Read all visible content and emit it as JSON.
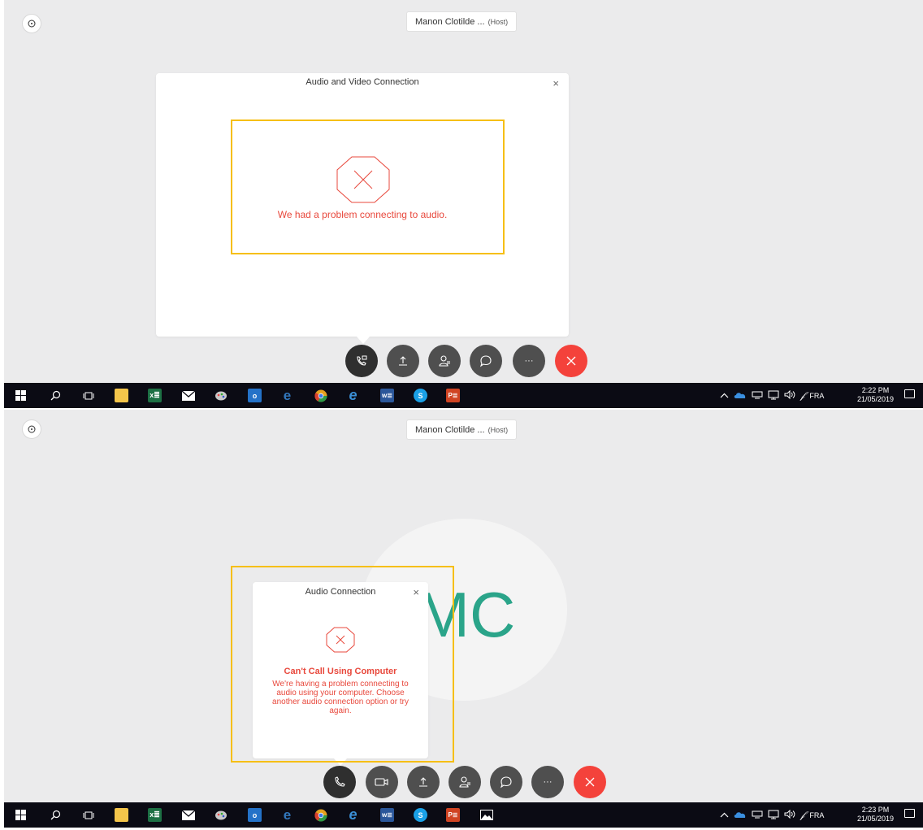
{
  "meeting": {
    "host_name": "Manon Clotilde ...",
    "host_tag": "(Host)"
  },
  "screen1": {
    "dialog": {
      "title": "Audio and Video Connection",
      "close": "×",
      "error_message": "We had a problem connecting to audio."
    },
    "controls": [
      "audio-video",
      "share",
      "participants",
      "chat",
      "more",
      "leave"
    ]
  },
  "screen2": {
    "avatar_initials": "MC",
    "dialog": {
      "title": "Audio Connection",
      "close": "×",
      "error_heading": "Can't Call Using Computer",
      "error_body": "We're having a problem connecting to audio using your computer. Choose another audio connection option or try again."
    },
    "controls": [
      "audio",
      "video",
      "share",
      "participants",
      "chat",
      "more",
      "leave"
    ]
  },
  "taskbar1": {
    "language": "FRA",
    "time": "2:22 PM",
    "date": "21/05/2019"
  },
  "taskbar2": {
    "language": "FRA",
    "time": "2:23 PM",
    "date": "21/05/2019"
  },
  "taskbar_apps": [
    {
      "name": "file-explorer",
      "color": "#f4c54a"
    },
    {
      "name": "excel",
      "glyph": "x≣",
      "color": "#1d7044"
    },
    {
      "name": "mail",
      "color": "#ffffff"
    },
    {
      "name": "paint",
      "color": "#c9c9c9"
    },
    {
      "name": "outlook",
      "glyph": "o",
      "color": "#2472c8"
    },
    {
      "name": "edge",
      "glyph": "e",
      "color": "#3277bc"
    },
    {
      "name": "chrome",
      "color": "#e4a120"
    },
    {
      "name": "internet-explorer",
      "glyph": "e",
      "color": "#3b8fd6"
    },
    {
      "name": "word",
      "glyph": "w≣",
      "color": "#2b579a"
    },
    {
      "name": "skype",
      "glyph": "S",
      "color": "#1aa0e6"
    },
    {
      "name": "powerpoint",
      "glyph": "P≣",
      "color": "#d04423"
    }
  ],
  "colors": {
    "accent_error": "#e8483c",
    "highlight": "#f6bf15",
    "leave_red": "#f4423b",
    "avatar_text": "#2aa489"
  }
}
